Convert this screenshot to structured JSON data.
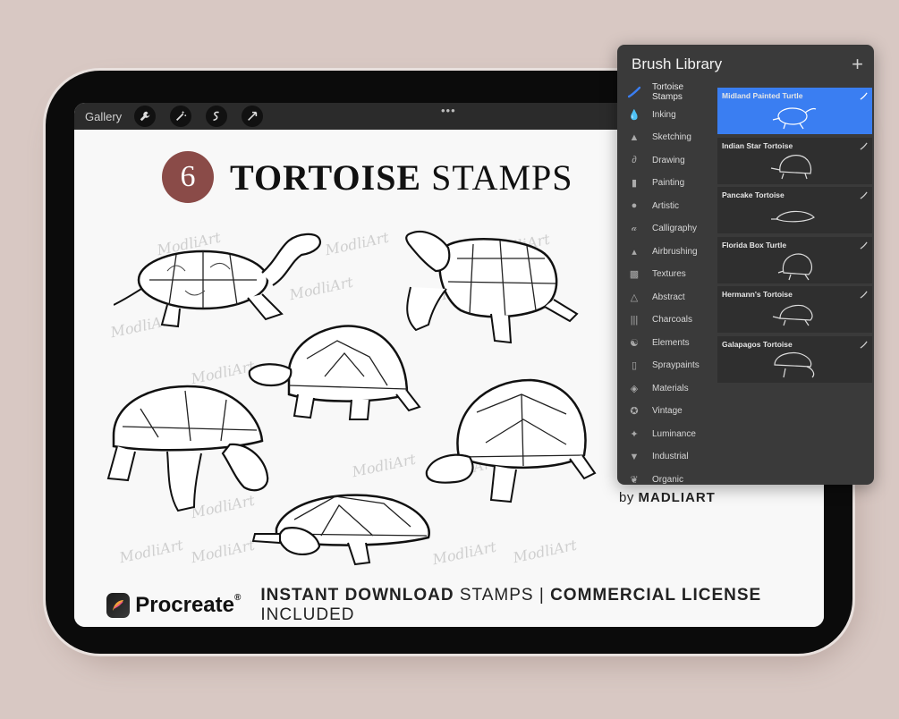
{
  "toolbar": {
    "gallery_label": "Gallery",
    "tools": [
      "wrench-icon",
      "magic-wand-icon",
      "selection-icon",
      "transform-arrow-icon"
    ],
    "more": "•••"
  },
  "canvas": {
    "badge_number": "6",
    "title_word1": "TORTOISE",
    "title_word2": "STAMPS",
    "watermark": "ModliArt",
    "footer": {
      "app_name": "Procreate",
      "registered": "®",
      "line_bold1": "INSTANT DOWNLOAD",
      "line_reg1": "STAMPS",
      "separator": "|",
      "line_bold2": "COMMERCIAL LICENSE",
      "line_reg2": "INCLUDED"
    }
  },
  "brush_library": {
    "title": "Brush Library",
    "add_icon": "plus-icon",
    "sets": [
      {
        "label": "Tortoise Stamps",
        "icon": "brush-stroke-icon",
        "active": true
      },
      {
        "label": "Inking",
        "icon": "ink-drop-icon"
      },
      {
        "label": "Sketching",
        "icon": "pencil-icon"
      },
      {
        "label": "Drawing",
        "icon": "swirl-icon"
      },
      {
        "label": "Painting",
        "icon": "paint-brush-icon"
      },
      {
        "label": "Artistic",
        "icon": "palette-icon"
      },
      {
        "label": "Calligraphy",
        "icon": "calligraphy-icon"
      },
      {
        "label": "Airbrushing",
        "icon": "airbrush-icon"
      },
      {
        "label": "Textures",
        "icon": "texture-icon"
      },
      {
        "label": "Abstract",
        "icon": "triangle-icon"
      },
      {
        "label": "Charcoals",
        "icon": "charcoal-icon"
      },
      {
        "label": "Elements",
        "icon": "yin-yang-icon"
      },
      {
        "label": "Spraypaints",
        "icon": "spray-can-icon"
      },
      {
        "label": "Materials",
        "icon": "cube-icon"
      },
      {
        "label": "Vintage",
        "icon": "star-badge-icon"
      },
      {
        "label": "Luminance",
        "icon": "sparkle-icon"
      },
      {
        "label": "Industrial",
        "icon": "anvil-icon"
      },
      {
        "label": "Organic",
        "icon": "leaf-icon"
      }
    ],
    "brushes": [
      {
        "name": "Midland Painted Turtle",
        "selected": true
      },
      {
        "name": "Indian Star Tortoise"
      },
      {
        "name": "Pancake Tortoise"
      },
      {
        "name": "Florida Box Turtle"
      },
      {
        "name": "Hermann's Tortoise"
      },
      {
        "name": "Galapagos Tortoise"
      }
    ],
    "accent_color": "#3a7ef2"
  },
  "byline": {
    "prefix": "by",
    "brand": "MADLIART"
  },
  "colors": {
    "background": "#d8c8c3",
    "badge": "#8a4b48",
    "panel": "#3a3a3a"
  }
}
